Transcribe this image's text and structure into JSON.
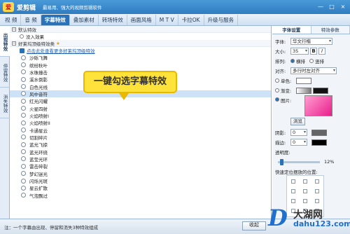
{
  "app": {
    "logo_text": "爱",
    "title": "爱剪辑",
    "slogan": "最易用、强大的视频剪辑软件"
  },
  "window_controls": [
    "—",
    "□",
    "×"
  ],
  "tabs": [
    {
      "label": "视 频"
    },
    {
      "label": "音 频"
    },
    {
      "label": "字幕特效"
    },
    {
      "label": "叠加素材"
    },
    {
      "label": "转场特效"
    },
    {
      "label": "画面风格"
    },
    {
      "label": "M T V"
    },
    {
      "label": "卡拉OK"
    },
    {
      "label": "升级与服务"
    }
  ],
  "active_tab": "字幕特效",
  "side_tabs": [
    {
      "label": "出现特效"
    },
    {
      "label": "停留特效"
    },
    {
      "label": "消失特效"
    }
  ],
  "list": {
    "default_group": "默认特效",
    "default_item": "没入效果",
    "favorites_group": "好莱坞顶级特效类",
    "favorites_link": "点击此处查看更多好莱坞顶级特效",
    "items": [
      "沙砾飞舞",
      "缤纷秋叶",
      "水珠撞击",
      "溪水倒影",
      "白色光线",
      "风中音符",
      "红光闪耀",
      "火星四射",
      "火焰喷射I",
      "火焰喷射II",
      "卡通星云",
      "切割碎片",
      "蓝光飞掠",
      "蓝光环绕",
      "蓝莹光环",
      "雷击碎裂",
      "梦幻迷光",
      "闪烁光斑",
      "星云扩散",
      "气泡飘过"
    ],
    "selected_item": "风中音符"
  },
  "callout": {
    "text": "一键勾选字幕特效"
  },
  "panel": {
    "tabs": [
      "字体设置",
      "特效参数"
    ],
    "font_label": "字体:",
    "font_value": "华文行楷",
    "size_label": "大小:",
    "size_value": "35",
    "bold": "B",
    "italic": "I",
    "arrange_label": "排列:",
    "arrange_options": [
      "横排",
      "竖排"
    ],
    "align_label": "对齐:",
    "align_value": "多行时左对齐",
    "solid_label": "单色:",
    "gradient_label": "渐变:",
    "image_label": "图片:",
    "browse": "浏览",
    "shadow_label": "阴影:",
    "shadow_value": "0",
    "stroke_label": "描边:",
    "stroke_value": "0",
    "opacity_label": "透明度:",
    "opacity_value": "12%",
    "quick_pos_label": "快速定位摆放的位置:"
  },
  "colors": {
    "titlebar": "#2f7cc0",
    "accent": "#2a72b8",
    "callout": "#ffe33a"
  },
  "status": {
    "note": "注：一个字幕由出现、停留和消失3种特效组成",
    "collect": "收起"
  },
  "watermark": {
    "d": "D",
    "cn": "大湖网",
    "url": "dahu123.com"
  }
}
